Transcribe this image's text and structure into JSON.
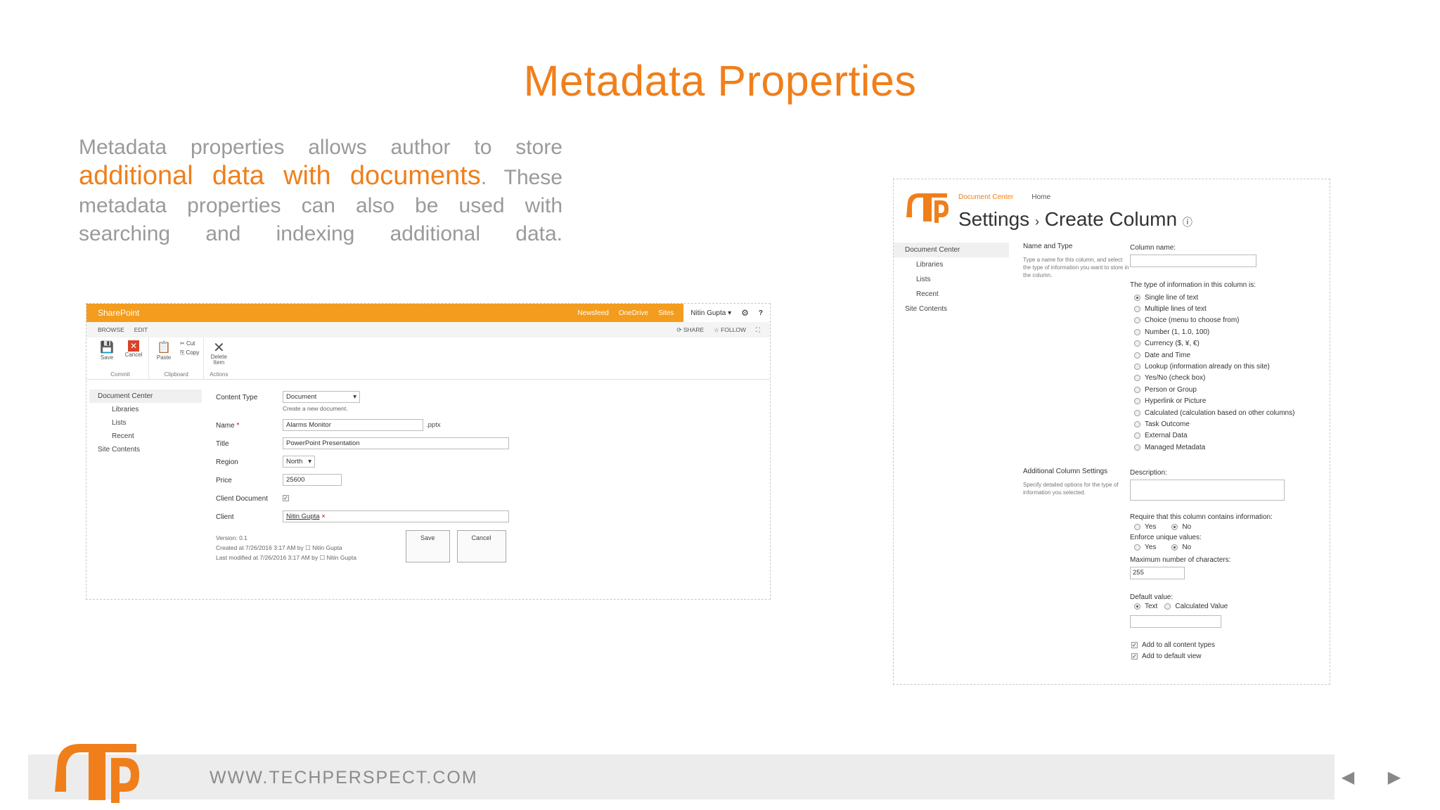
{
  "slide": {
    "title": "Metadata Properties",
    "intro_part1": "Metadata properties allows author to store",
    "intro_highlight": "additional data with documents",
    "intro_part2": ". These metadata properties can also be used with searching and indexing additional data.",
    "footer_url": "WWW.TECHPERSPECT.COM",
    "accent_color": "#f07f1b"
  },
  "sp_screen": {
    "brand": "SharePoint",
    "top_links": [
      "Newsfeed",
      "OneDrive",
      "Sites"
    ],
    "user": "Nitin Gupta ▾",
    "gear_icon": "gear-icon",
    "help_icon": "?",
    "tabs": [
      "BROWSE",
      "EDIT"
    ],
    "tab_actions": [
      "SHARE",
      "FOLLOW"
    ],
    "ribbon": {
      "commit_label": "Commit",
      "clipboard_label": "Clipboard",
      "actions_label": "Actions",
      "save": "Save",
      "cancel": "Cancel",
      "paste": "Paste",
      "cut": "Cut",
      "copy": "Copy",
      "delete_item": "Delete Item"
    },
    "nav": [
      "Document Center",
      "Libraries",
      "Lists",
      "Recent",
      "Site Contents"
    ],
    "form": {
      "content_type_label": "Content Type",
      "content_type_value": "Document",
      "content_type_hint": "Create a new document.",
      "name_label": "Name",
      "name_required": "*",
      "name_value": "Alarms Monitor",
      "name_ext": ".pptx",
      "title_label": "Title",
      "title_value": "PowerPoint Presentation",
      "region_label": "Region",
      "region_value": "North",
      "price_label": "Price",
      "price_value": "25600",
      "client_doc_label": "Client Document",
      "client_label": "Client",
      "client_value": "Nitin Gupta",
      "version": "Version: 0.1",
      "created": "Created at 7/26/2016 3:17 AM  by",
      "created_by": "Nitin Gupta",
      "modified": "Last modified at 7/26/2016 3:17 AM  by",
      "modified_by": "Nitin Gupta",
      "save": "Save",
      "cancel": "Cancel"
    }
  },
  "cc_screen": {
    "crumb1": "Document Center",
    "crumb2": "Home",
    "title_settings": "Settings",
    "title_sep": "›",
    "title_page": "Create Column",
    "nav": [
      "Document Center",
      "Libraries",
      "Lists",
      "Recent",
      "Site Contents"
    ],
    "name_type_section": "Name and Type",
    "name_type_desc": "Type a name for this column, and select the type of information you want to store in the column.",
    "column_name_label": "Column name:",
    "type_label": "The type of information in this column is:",
    "types": [
      "Single line of text",
      "Multiple lines of text",
      "Choice (menu to choose from)",
      "Number (1, 1.0, 100)",
      "Currency ($, ¥, €)",
      "Date and Time",
      "Lookup (information already on this site)",
      "Yes/No (check box)",
      "Person or Group",
      "Hyperlink or Picture",
      "Calculated (calculation based on other columns)",
      "Task Outcome",
      "External Data",
      "Managed Metadata"
    ],
    "additional_section": "Additional Column Settings",
    "additional_desc": "Specify detailed options for the type of information you selected.",
    "description_label": "Description:",
    "require_label": "Require that this column contains information:",
    "unique_label": "Enforce unique values:",
    "yes": "Yes",
    "no": "No",
    "max_chars_label": "Maximum number of characters:",
    "max_chars_value": "255",
    "default_label": "Default value:",
    "default_text": "Text",
    "default_calc": "Calculated Value",
    "add_all": "Add to all content types",
    "add_default": "Add to default view"
  }
}
